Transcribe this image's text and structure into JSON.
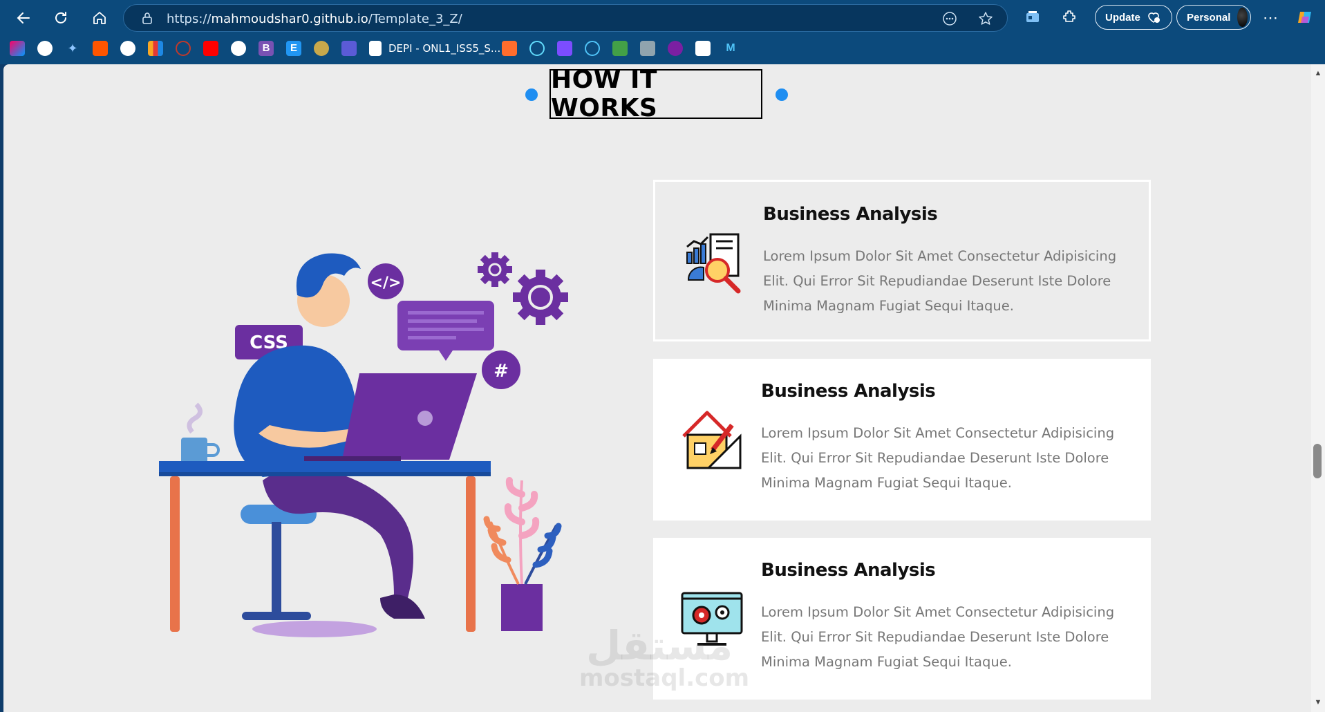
{
  "browser": {
    "url_prefix": "https://",
    "url_host": "mahmoudshar0.github.io",
    "url_path": "/Template_3_Z/",
    "update_label": "Update",
    "profile_label": "Personal",
    "bookmark_folder_label": "DEPI - ONL1_ISS5_S..."
  },
  "section": {
    "title": "HOW IT WORKS",
    "accent_color": "#1f8ef1"
  },
  "illustration": {
    "css_bubble": "CSS",
    "code_bubble": "</>",
    "hash_bubble": "#"
  },
  "cards": [
    {
      "title": "Business Analysis",
      "text": "Lorem Ipsum Dolor Sit Amet Consectetur Adipisicing Elit. Qui Error Sit Repudiandae Deserunt Iste Dolore Minima Magnam Fugiat Sequi Itaque.",
      "icon": "analytics-magnifier-icon"
    },
    {
      "title": "Business Analysis",
      "text": "Lorem Ipsum Dolor Sit Amet Consectetur Adipisicing Elit. Qui Error Sit Repudiandae Deserunt Iste Dolore Minima Magnam Fugiat Sequi Itaque.",
      "icon": "house-design-icon"
    },
    {
      "title": "Business Analysis",
      "text": "Lorem Ipsum Dolor Sit Amet Consectetur Adipisicing Elit. Qui Error Sit Repudiandae Deserunt Iste Dolore Minima Magnam Fugiat Sequi Itaque.",
      "icon": "monitor-gears-icon"
    }
  ],
  "watermark": {
    "arabic": "مستقل",
    "latin": "mostaql.com"
  }
}
